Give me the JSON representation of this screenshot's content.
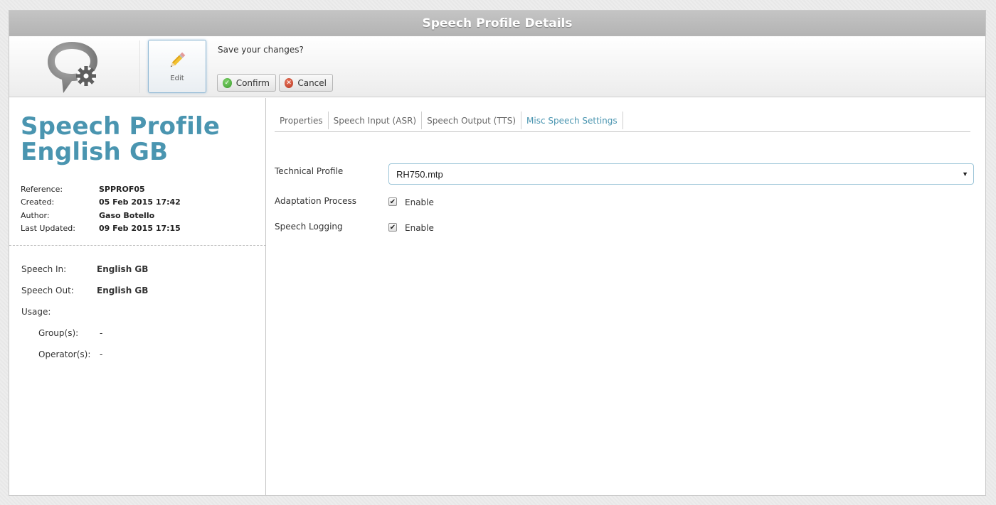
{
  "window": {
    "title": "Speech Profile Details"
  },
  "toolbar": {
    "edit_label": "Edit",
    "prompt": "Save your changes?",
    "confirm_label": "Confirm",
    "cancel_label": "Cancel"
  },
  "profile": {
    "title_line1": "Speech Profile",
    "title_line2": "English GB",
    "meta": [
      {
        "key": "Reference:",
        "value": "SPPROF05"
      },
      {
        "key": "Created:",
        "value": "05 Feb 2015 17:42"
      },
      {
        "key": "Author:",
        "value": "Gaso Botello"
      },
      {
        "key": "Last Updated:",
        "value": "09 Feb 2015 17:15"
      }
    ],
    "summary": {
      "speech_in_label": "Speech In:",
      "speech_in_value": "English GB",
      "speech_out_label": "Speech Out:",
      "speech_out_value": "English GB",
      "usage_label": "Usage:",
      "groups_label": "Group(s):",
      "groups_value": "-",
      "operators_label": "Operator(s):",
      "operators_value": "-"
    }
  },
  "tabs": [
    {
      "label": "Properties"
    },
    {
      "label": "Speech Input (ASR)"
    },
    {
      "label": "Speech Output (TTS)"
    },
    {
      "label": "Misc Speech Settings",
      "active": true
    }
  ],
  "form": {
    "technical_profile_label": "Technical Profile",
    "technical_profile_value": "RH750.mtp",
    "adaptation_label": "Adaptation Process",
    "adaptation_checked": true,
    "adaptation_option": "Enable",
    "logging_label": "Speech Logging",
    "logging_checked": true,
    "logging_option": "Enable"
  },
  "colors": {
    "accent": "#4a95b0",
    "titlebar": "#b8b8b8",
    "confirm_icon": "#3a9a2b",
    "cancel_icon": "#b8341e"
  },
  "icons": {
    "logo": "speech-bubble-gear-icon",
    "edit": "pencil-icon",
    "confirm": "check-circle-icon",
    "cancel": "x-circle-icon",
    "select_caret": "caret-down-icon",
    "checkbox": "checkmark-icon"
  }
}
